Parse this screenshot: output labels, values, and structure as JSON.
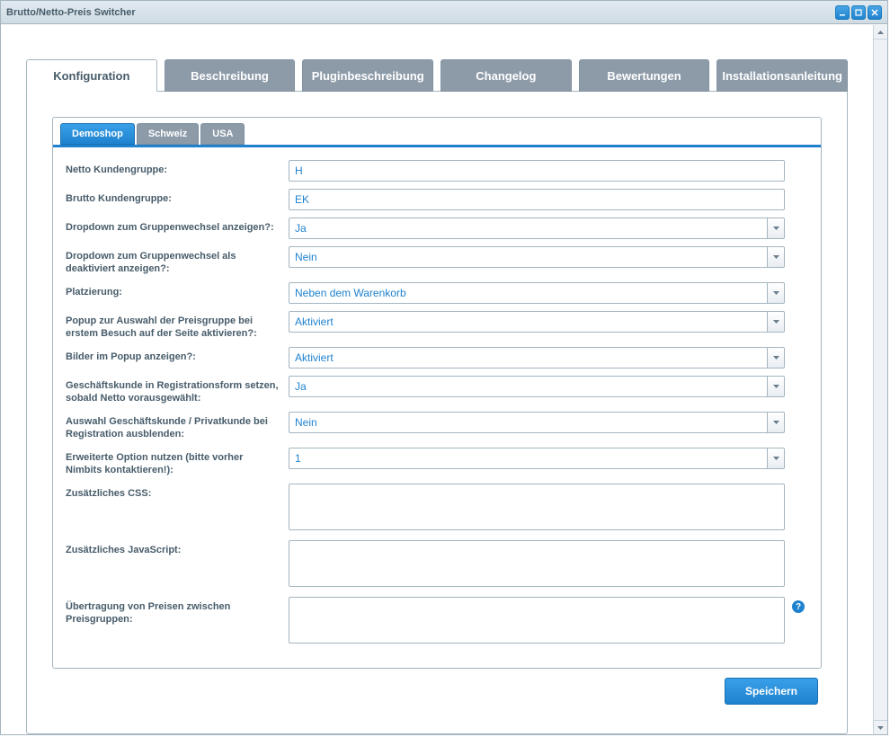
{
  "window": {
    "title": "Brutto/Netto-Preis Switcher"
  },
  "tabs": {
    "main": [
      "Konfiguration",
      "Beschreibung",
      "Pluginbeschreibung",
      "Changelog",
      "Bewertungen",
      "Installationsanleitung"
    ],
    "sub": [
      "Demoshop",
      "Schweiz",
      "USA"
    ]
  },
  "labels": {
    "netto": "Netto Kundengruppe:",
    "brutto": "Brutto Kundengruppe:",
    "dropdown_show": "Dropdown zum Gruppenwechsel anzeigen?:",
    "dropdown_disabled": "Dropdown zum Gruppenwechsel als deaktiviert anzeigen?:",
    "placement": "Platzierung:",
    "popup": "Popup zur Auswahl der Preisgruppe bei erstem Besuch auf der Seite aktivieren?:",
    "images": "Bilder im Popup anzeigen?:",
    "reg_business": "Geschäftskunde in Registrationsform setzen, sobald Netto vorausgewählt:",
    "reg_hide": "Auswahl Geschäftskunde / Privatkunde bei Registration ausblenden:",
    "extended": "Erweiterte Option nutzen (bitte vorher Nimbits kontaktieren!):",
    "css": "Zusätzliches CSS:",
    "js": "Zusätzliches JavaScript:",
    "transfer": "Übertragung von Preisen zwischen Preisgruppen:"
  },
  "values": {
    "netto": "H",
    "brutto": "EK",
    "dropdown_show": "Ja",
    "dropdown_disabled": "Nein",
    "placement": "Neben dem Warenkorb",
    "popup": "Aktiviert",
    "images": "Aktiviert",
    "reg_business": "Ja",
    "reg_hide": "Nein",
    "extended": "1",
    "css": "",
    "js": "",
    "transfer": ""
  },
  "buttons": {
    "save": "Speichern"
  }
}
